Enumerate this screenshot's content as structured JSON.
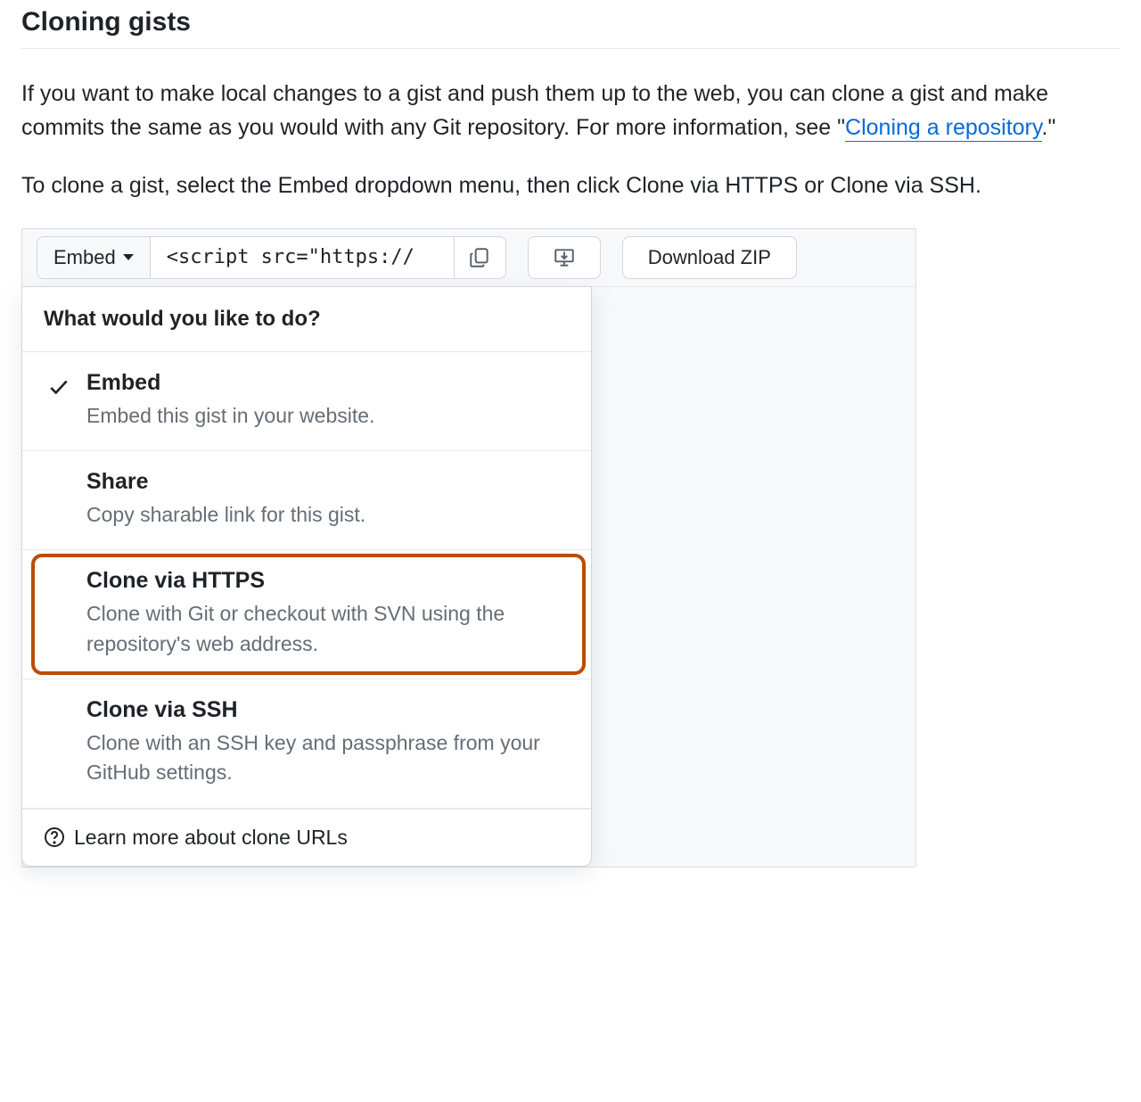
{
  "heading": "Cloning gists",
  "intro": {
    "para1_a": "If you want to make local changes to a gist and push them up to the web, you can clone a gist and make commits the same as you would with any Git repository. For more information, see \"",
    "para1_link": "Cloning a repository",
    "para1_b": ".\"",
    "para2": "To clone a gist, select the Embed dropdown menu, then click Clone via HTTPS or Clone via SSH."
  },
  "toolbar": {
    "embed_label": "Embed",
    "embed_code": "<script src=\"https://",
    "download_label": "Download ZIP"
  },
  "dropdown": {
    "header": "What would you like to do?",
    "options": [
      {
        "title": "Embed",
        "desc": "Embed this gist in your website.",
        "checked": true,
        "highlight": false
      },
      {
        "title": "Share",
        "desc": "Copy sharable link for this gist.",
        "checked": false,
        "highlight": false
      },
      {
        "title": "Clone via HTTPS",
        "desc": "Clone with Git or checkout with SVN using the repository's web address.",
        "checked": false,
        "highlight": true
      },
      {
        "title": "Clone via SSH",
        "desc": "Clone with an SSH key and passphrase from your GitHub settings.",
        "checked": false,
        "highlight": false
      }
    ],
    "learn_more": "Learn more about clone URLs"
  }
}
